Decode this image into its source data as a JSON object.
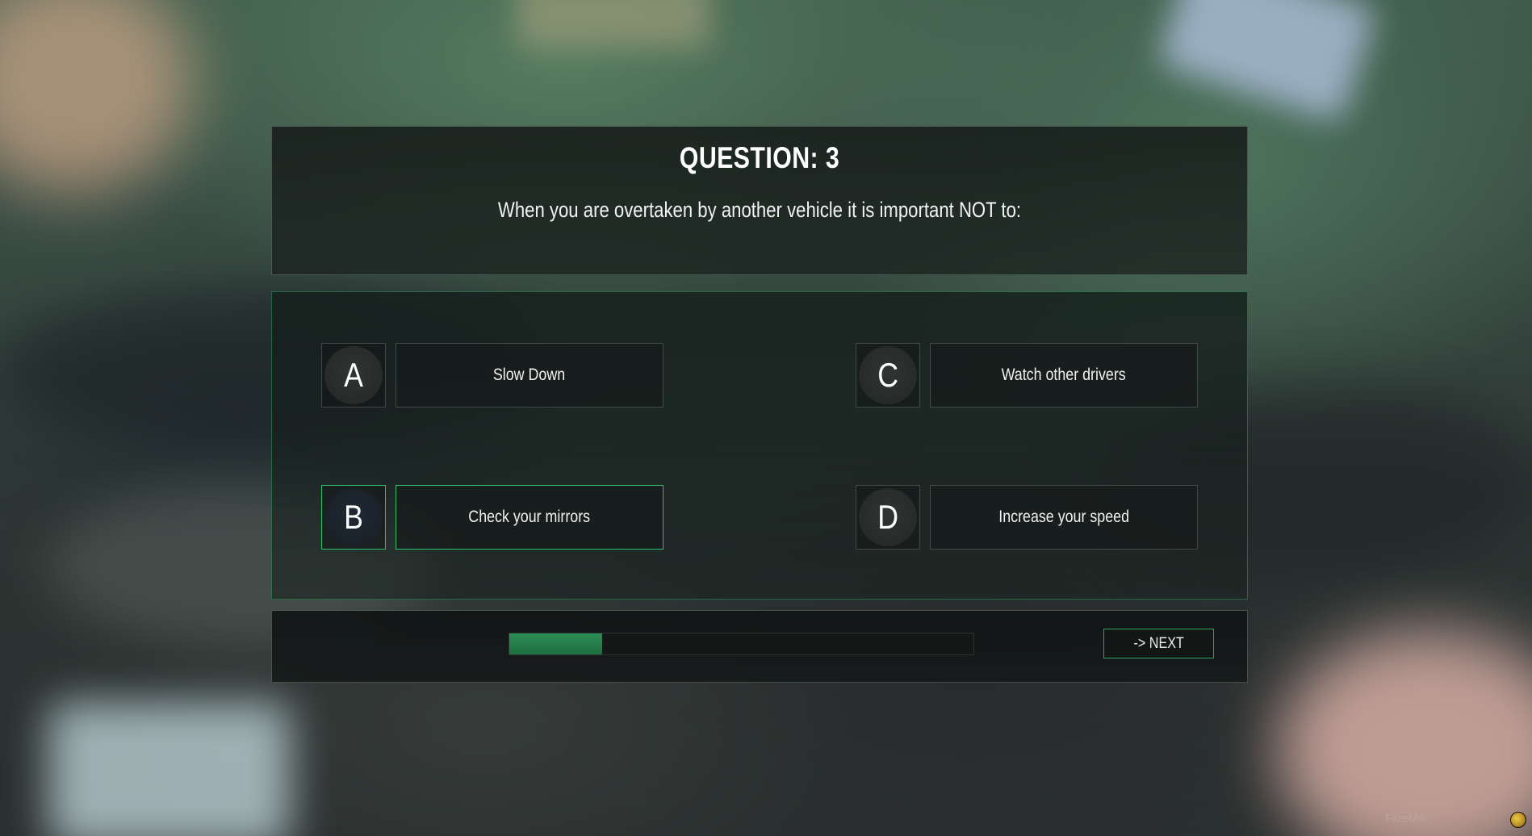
{
  "quiz": {
    "question_title": "QUESTION: 3",
    "question_text": "When you are overtaken by another vehicle it is important NOT to:",
    "options": [
      {
        "letter": "A",
        "text": "Slow Down",
        "selected": false
      },
      {
        "letter": "B",
        "text": "Check your mirrors",
        "selected": true
      },
      {
        "letter": "C",
        "text": "Watch other drivers",
        "selected": false
      },
      {
        "letter": "D",
        "text": "Increase your speed",
        "selected": false
      }
    ]
  },
  "footer": {
    "progress_fraction": 0.2,
    "next_label": "-> NEXT"
  },
  "watermark": {
    "text": "FiveM®"
  },
  "colors": {
    "accent_green": "#2fbf6e",
    "progress_fill": "#2d8e56"
  }
}
